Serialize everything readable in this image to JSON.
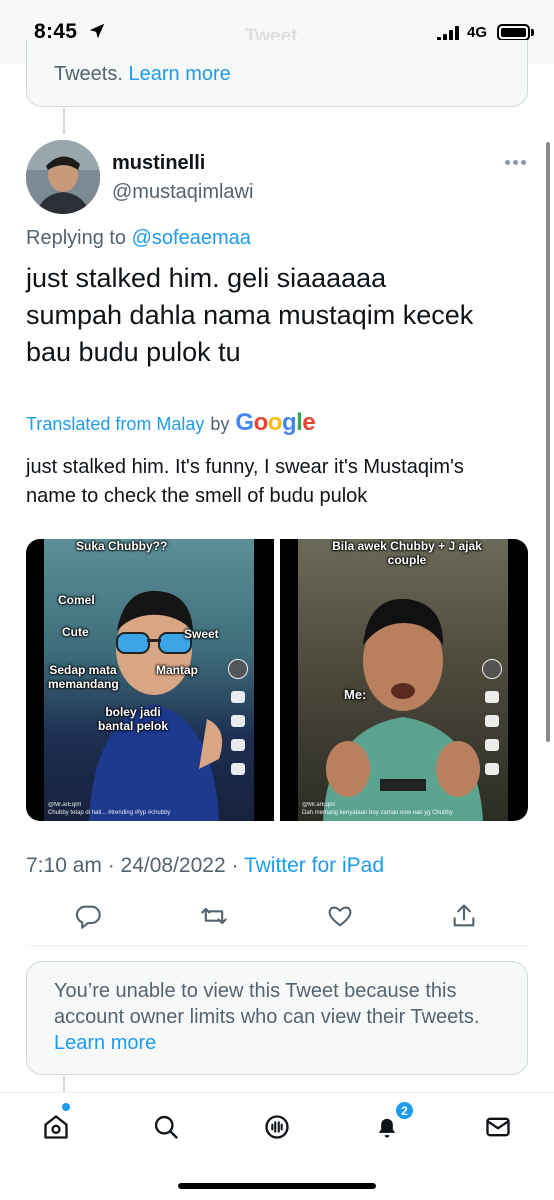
{
  "status_bar": {
    "time": "8:45",
    "ghost_title": "Tweet",
    "network": "4G"
  },
  "notice_top": {
    "text": "Tweets.",
    "link": "Learn more"
  },
  "tweet": {
    "display_name": "mustinelli",
    "handle": "@mustaqimlawi",
    "replying_prefix": "Replying to",
    "replying_to": "@sofeaemaa",
    "text": "just stalked him. geli siaaaaaa\nsumpah dahla nama mustaqim kecek\nbau budu pulok tu",
    "translated_label": "Translated from Malay",
    "translated_by": "by",
    "translator_name": "Google",
    "translation": "just stalked him. It's funny, I swear it's Mustaqim's\nname to check the smell of budu pulok",
    "timestamp": "7:10 am · 24/08/2022 ·",
    "source": "Twitter for iPad"
  },
  "media": {
    "left": {
      "top_caption": "Suka Chubby??",
      "stickers": [
        "Comel",
        "Cute",
        "Sweet",
        "Sedap mata memandang",
        "Mantap",
        "boley jadi bantal pelok"
      ],
      "username": "@Mr.arEqim",
      "caption": "Chubby tetap di hati... #trending #fyp #chubby"
    },
    "right": {
      "top_caption": "Bila awek Chubby + J ajak couple",
      "sticker": "Me:",
      "username": "@Mr.arEqim",
      "caption": "Dah memang kenyataan boy zaman now nak yg Chubby"
    }
  },
  "actions": {
    "reply": "reply-icon",
    "retweet": "retweet-icon",
    "like": "heart-icon",
    "share": "share-icon"
  },
  "notice_bottom": {
    "text": "You’re unable to view this Tweet because this account owner limits who can view their Tweets.",
    "link": "Learn more"
  },
  "tab_bar": {
    "notifications_badge": "2"
  },
  "colors": {
    "accent": "#1d9bf0",
    "secondary_text": "#536471",
    "border": "#cfd9de"
  }
}
